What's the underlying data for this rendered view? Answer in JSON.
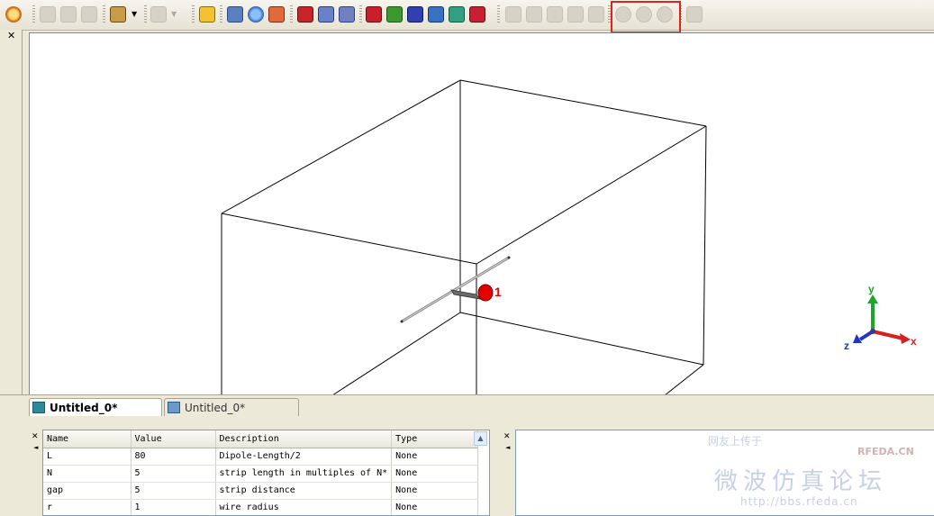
{
  "tabs": [
    {
      "label": "Untitled_0*",
      "active": true
    },
    {
      "label": "Untitled_0*",
      "active": false
    }
  ],
  "viewport": {
    "port_label": "1",
    "axes": {
      "x": "x",
      "y": "y",
      "z": "z"
    }
  },
  "params_table": {
    "headers": [
      "Name",
      "Value",
      "Description",
      "Type"
    ],
    "rows": [
      [
        "L",
        "80",
        "Dipole-Length/2",
        "None"
      ],
      [
        "N",
        "5",
        "strip length in multiples of N*",
        "None"
      ],
      [
        "gap",
        "5",
        "strip distance",
        "None"
      ],
      [
        "r",
        "1",
        "wire radius",
        "None"
      ]
    ]
  },
  "watermark": {
    "line1": "网友上传于",
    "brand": "RFEDA.CN",
    "forum": "微波仿真论坛",
    "url": "http://bbs.rfeda.cn"
  },
  "colors": {
    "highlight": "#e0231a",
    "port": "#e30000",
    "axis_x": "#d92020",
    "axis_y": "#1fa52c",
    "axis_z": "#2333c8"
  }
}
